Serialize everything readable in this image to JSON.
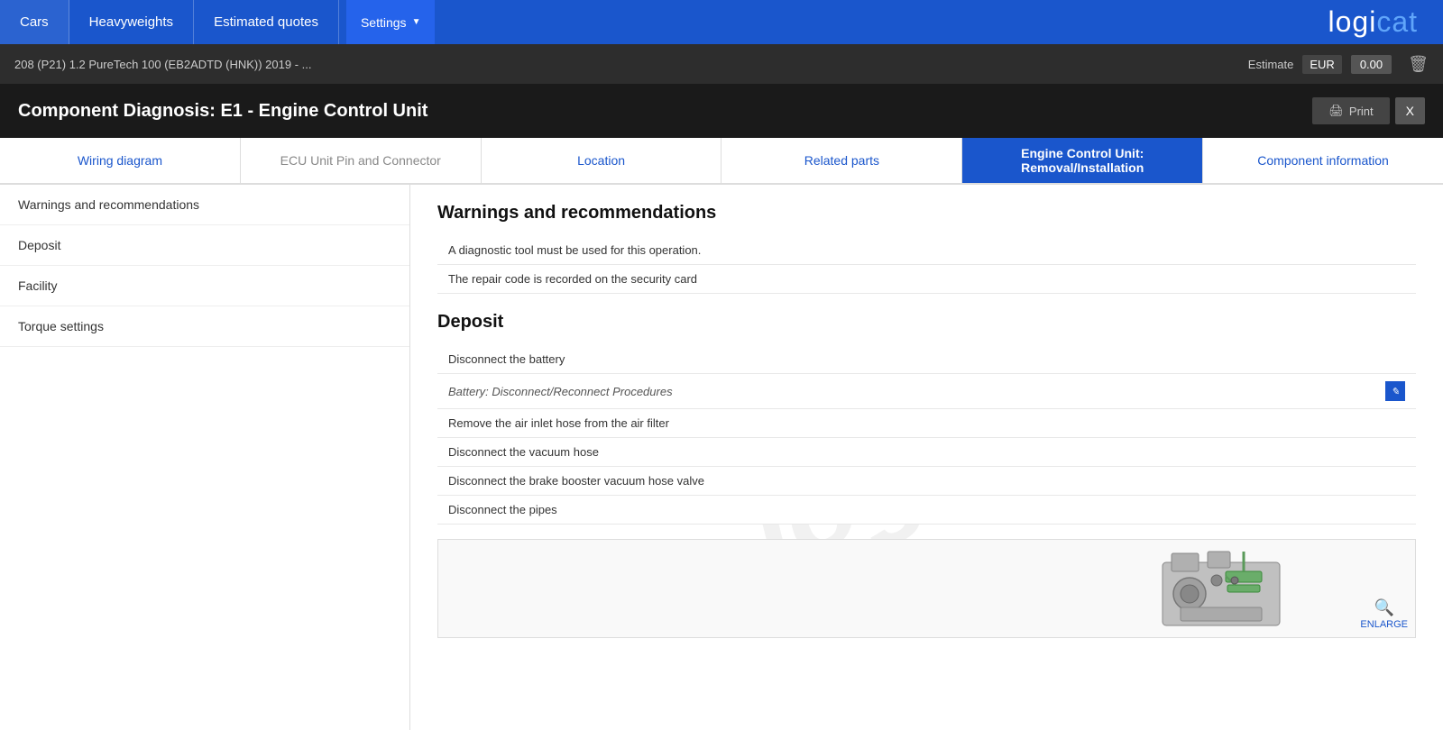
{
  "nav": {
    "items": [
      {
        "label": "Cars",
        "active": true
      },
      {
        "label": "Heavyweights",
        "active": false
      },
      {
        "label": "Estimated quotes",
        "active": false
      }
    ],
    "settings_label": "Settings",
    "logo": "logicat"
  },
  "breadcrumb": {
    "text": "208 (P21) 1.2 PureTech 100 (EB2ADTD (HNK)) 2019 - ...",
    "estimate_label": "Estimate",
    "estimate_currency": "EUR",
    "estimate_value": "0.00"
  },
  "page": {
    "title": "Component Diagnosis: E1 - Engine Control Unit",
    "print_label": "Print",
    "close_label": "X"
  },
  "tabs": [
    {
      "label": "Wiring diagram",
      "active": false,
      "blue": true
    },
    {
      "label": "ECU Unit Pin and Connector",
      "active": false,
      "blue": false
    },
    {
      "label": "Location",
      "active": false,
      "blue": true
    },
    {
      "label": "Related parts",
      "active": false,
      "blue": true
    },
    {
      "label": "Engine Control Unit: Removal/Installation",
      "active": true,
      "blue": false
    },
    {
      "label": "Component information",
      "active": false,
      "blue": true
    }
  ],
  "sidebar": {
    "items": [
      {
        "label": "Warnings and recommendations"
      },
      {
        "label": "Deposit"
      },
      {
        "label": "Facility"
      },
      {
        "label": "Torque settings"
      }
    ]
  },
  "main": {
    "watermark": "logicat",
    "section1": {
      "title": "Warnings and recommendations",
      "items": [
        {
          "text": "A diagnostic tool must be used for this operation.",
          "italic": false
        },
        {
          "text": "The repair code is recorded on the security card",
          "italic": false
        }
      ]
    },
    "section2": {
      "title": "Deposit",
      "items": [
        {
          "text": "Disconnect the battery",
          "italic": false,
          "has_link": false
        },
        {
          "text": "Battery: Disconnect/Reconnect Procedures",
          "italic": true,
          "has_link": true
        },
        {
          "text": "Remove the air inlet hose from the air filter",
          "italic": false,
          "has_link": false
        },
        {
          "text": "Disconnect the vacuum hose",
          "italic": false,
          "has_link": false
        },
        {
          "text": "Disconnect the brake booster vacuum hose valve",
          "italic": false,
          "has_link": false
        },
        {
          "text": "Disconnect the pipes",
          "italic": false,
          "has_link": false
        }
      ]
    },
    "enlarge_label": "ENLARGE"
  }
}
